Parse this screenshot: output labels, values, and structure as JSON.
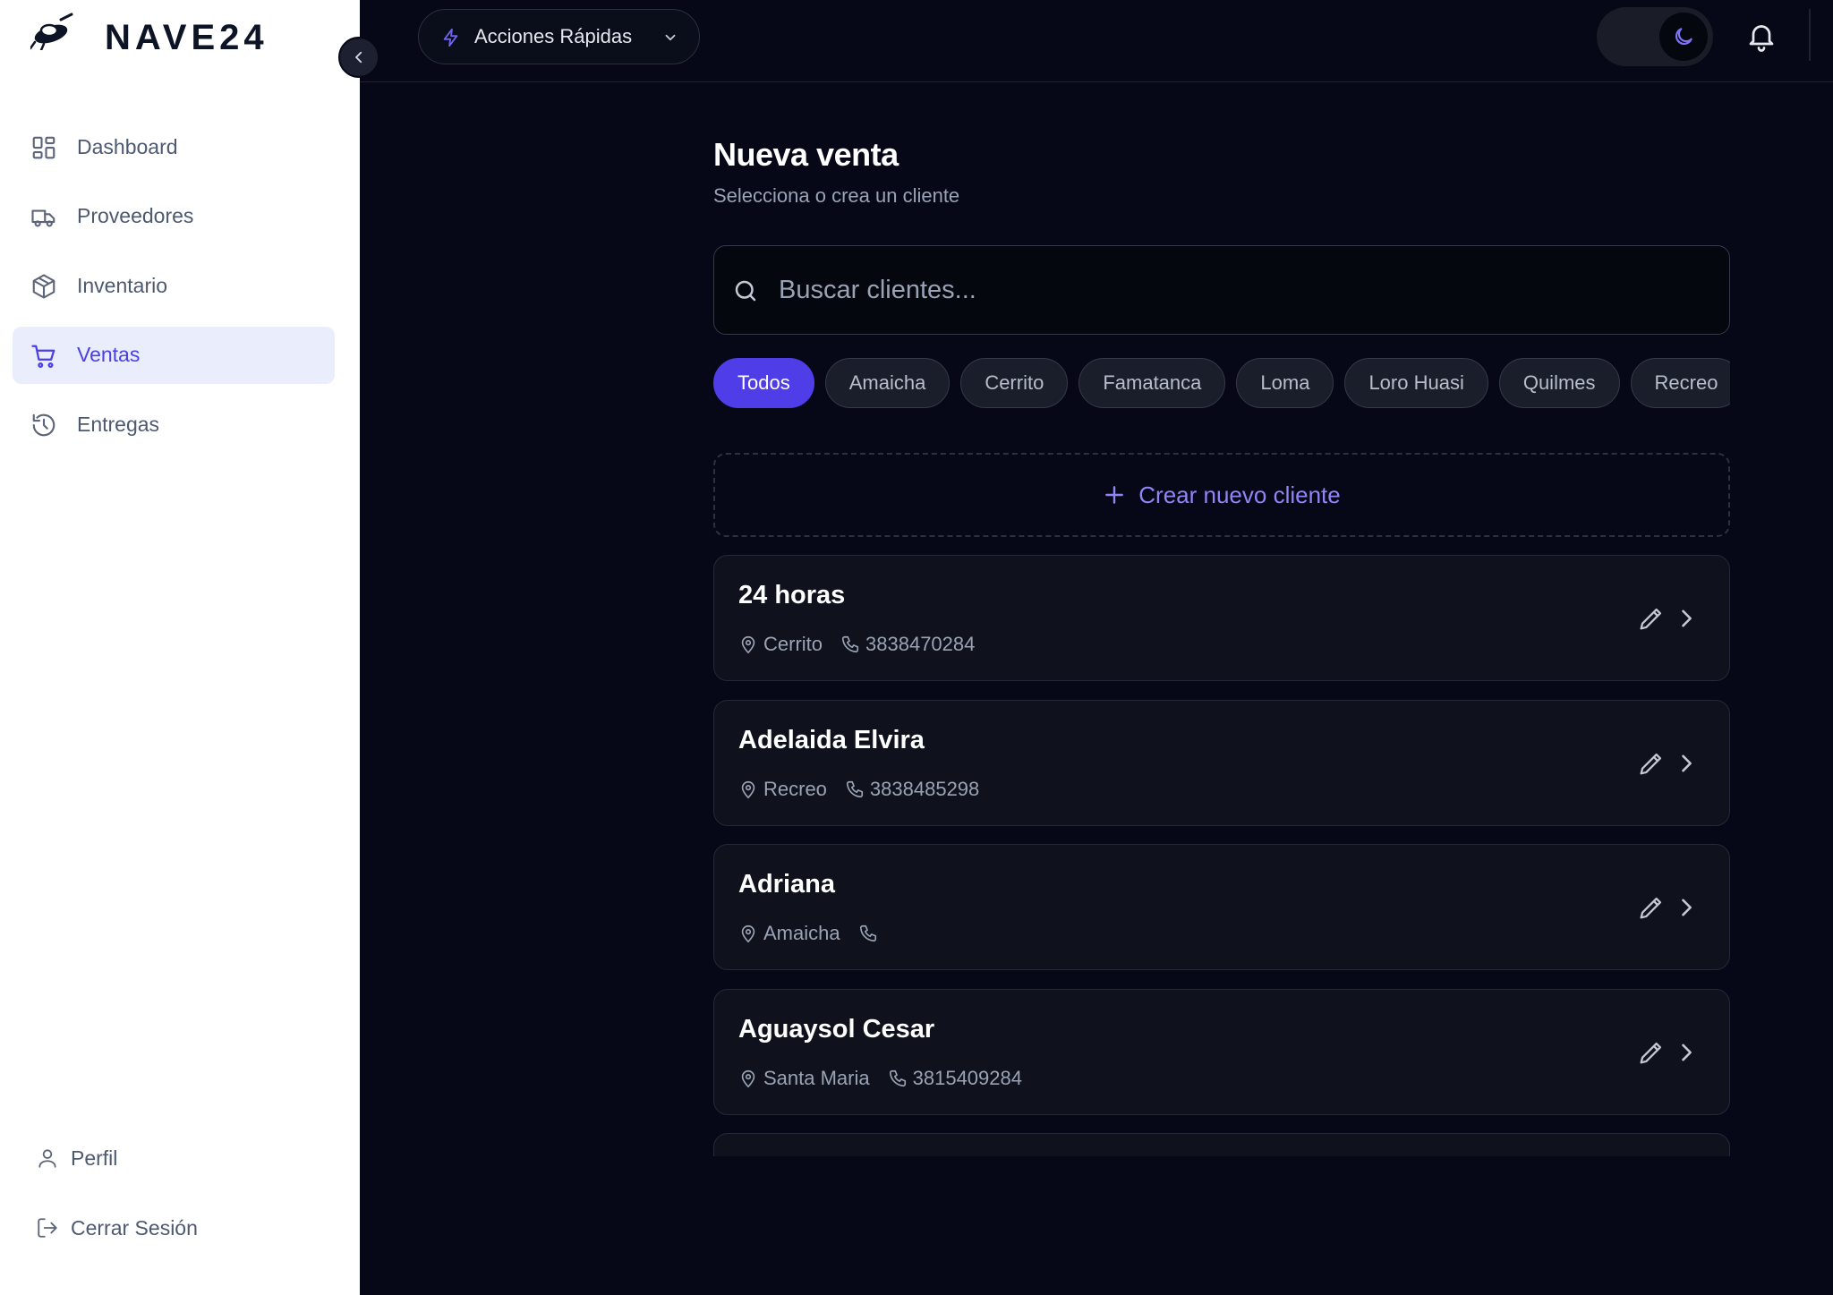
{
  "app": {
    "brand": "NAVE24"
  },
  "sidebar": {
    "items": [
      {
        "label": "Dashboard",
        "icon": "dashboard-icon"
      },
      {
        "label": "Proveedores",
        "icon": "truck-icon"
      },
      {
        "label": "Inventario",
        "icon": "box-icon"
      },
      {
        "label": "Ventas",
        "icon": "cart-icon",
        "active": true
      },
      {
        "label": "Entregas",
        "icon": "history-icon"
      }
    ],
    "footer": [
      {
        "label": "Perfil",
        "icon": "user-icon"
      },
      {
        "label": "Cerrar Sesión",
        "icon": "logout-icon"
      }
    ]
  },
  "header": {
    "quick_actions_label": "Acciones Rápidas",
    "theme": "dark"
  },
  "main": {
    "title": "Nueva venta",
    "subtitle": "Selecciona o crea un cliente",
    "search_placeholder": "Buscar clientes...",
    "filters": [
      "Todos",
      "Amaicha",
      "Cerrito",
      "Famatanca",
      "Loma",
      "Loro Huasi",
      "Quilmes",
      "Recreo"
    ],
    "active_filter": "Todos",
    "create_label": "Crear nuevo cliente",
    "clients": [
      {
        "name": "24 horas",
        "location": "Cerrito",
        "phone": "3838470284"
      },
      {
        "name": "Adelaida Elvira",
        "location": "Recreo",
        "phone": "3838485298"
      },
      {
        "name": "Adriana",
        "location": "Amaicha",
        "phone": ""
      },
      {
        "name": "Aguaysol Cesar",
        "location": "Santa Maria",
        "phone": "3815409284"
      }
    ]
  },
  "colors": {
    "accent": "#4f3ee8",
    "accent_text": "#8f85f5",
    "background": "#060818",
    "card": "#0f121d",
    "sidebar": "#ffffff"
  }
}
